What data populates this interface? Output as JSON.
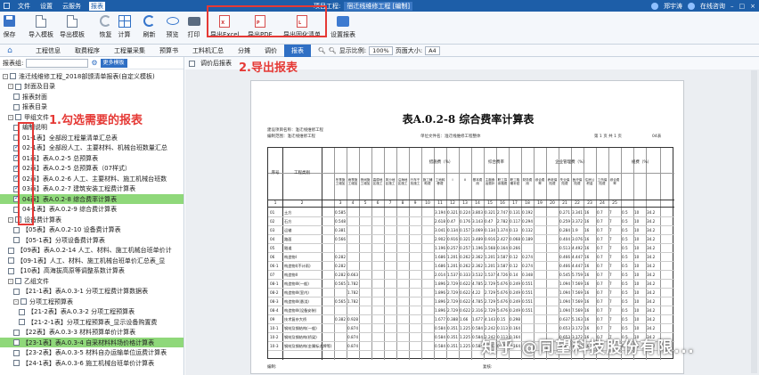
{
  "titlebar": {
    "menus": [
      "文件",
      "设置",
      "云服务",
      "报表"
    ],
    "active_menu": "报表",
    "center": "项目工程:",
    "project": "宿迁线维修工程 [编制]",
    "right": [
      "郑宇涛",
      "在线咨询",
      "–",
      "□",
      "×"
    ]
  },
  "toolbar": {
    "buttons": [
      {
        "label": "保存",
        "icon": "save-icon"
      },
      {
        "label": "导入模板",
        "icon": "import-icon"
      },
      {
        "label": "导出模板",
        "icon": "export-template-icon"
      },
      {
        "label": "恢复",
        "icon": "restore-icon"
      },
      {
        "label": "计算",
        "icon": "calculate-icon"
      },
      {
        "label": "刷新",
        "icon": "refresh-icon"
      },
      {
        "label": "预览",
        "icon": "preview-icon"
      },
      {
        "label": "打印",
        "icon": "print-icon"
      },
      {
        "label": "导出Excel",
        "icon": "excel-icon"
      },
      {
        "label": "导出PDF",
        "icon": "pdf-icon"
      },
      {
        "label": "导出固化清单",
        "icon": "export-list-icon"
      },
      {
        "label": "设置报表",
        "icon": "settings-icon"
      }
    ]
  },
  "tabs": [
    "工程信息",
    "取费程序",
    "工程量采集",
    "预算书",
    "工料机汇总",
    "分摊",
    "调价",
    "报表"
  ],
  "active_tab": "报表",
  "zoom": {
    "label": "显示比例:",
    "value": "100%",
    "page_label": "页面大小:",
    "page_value": "A4"
  },
  "left": {
    "search_label": "报表组:",
    "button": "更多模板",
    "after_label": "调价后报表"
  },
  "tree": [
    {
      "lvl": 0,
      "tog": "-",
      "cb": false,
      "text": "淮迁线维修工程_2018部颁清单报表(自定义模板)"
    },
    {
      "lvl": 1,
      "tog": "-",
      "cb": false,
      "text": "封面及目录"
    },
    {
      "lvl": 2,
      "cb": false,
      "text": "报表封面"
    },
    {
      "lvl": 2,
      "cb": false,
      "text": "报表目录"
    },
    {
      "lvl": 1,
      "tog": "-",
      "cb": false,
      "text": "甲组文件"
    },
    {
      "lvl": 2,
      "cb": false,
      "text": "编制说明"
    },
    {
      "lvl": 2,
      "cb": false,
      "text": "01-1表】全部段工程量清单汇总表"
    },
    {
      "lvl": 2,
      "cb": true,
      "text": "02-1表】全部段人工、主要材料、机械台班数量汇总"
    },
    {
      "lvl": 2,
      "cb": true,
      "text": "01表】表A.0.2-5 总预算表"
    },
    {
      "lvl": 2,
      "cb": true,
      "text": "02表】表A.0.2-5 总预算表（07样式）"
    },
    {
      "lvl": 2,
      "cb": true,
      "text": "02表】表A.0.2-6 人工、主要材料、施工机械台班数"
    },
    {
      "lvl": 2,
      "cb": true,
      "text": "03表】表A.0.2-7 建筑安装工程费计算表"
    },
    {
      "lvl": 2,
      "cb": true,
      "text": "04表】表A.0.2-8 综合费率计算表",
      "hl": true
    },
    {
      "lvl": 2,
      "cb": false,
      "text": "04-1表】表A.0.2-9 综合费计算表"
    },
    {
      "lvl": 1,
      "tog": "-",
      "cb": false,
      "text": "设备费计算表"
    },
    {
      "lvl": 2,
      "cb": false,
      "text": "【05表】表A.0.2-10 设备费计算表"
    },
    {
      "lvl": 2,
      "cb": false,
      "text": "【05-1表】分项设备费计算表"
    },
    {
      "lvl": 1,
      "cb": false,
      "text": "【09表】表A.0.2-14 人工、材料、施工机械台班单价计"
    },
    {
      "lvl": 1,
      "cb": false,
      "text": "【09-1表】人工、材料、施工机械台班单价汇总表_显"
    },
    {
      "lvl": 1,
      "cb": false,
      "text": "【10表】高海拔高原等调整系数计算表"
    },
    {
      "lvl": 1,
      "tog": "-",
      "cb": false,
      "text": "乙组文件"
    },
    {
      "lvl": 2,
      "cb": false,
      "text": "【21-1表】表A.0.3-1 分项工程费计算数据表"
    },
    {
      "lvl": 2,
      "tog": "-",
      "cb": false,
      "text": "分项工程预算表"
    },
    {
      "lvl": 3,
      "cb": false,
      "text": "【21-2表】表A.0.3-2 分项工程预算表"
    },
    {
      "lvl": 3,
      "cb": false,
      "text": "【21-2-1表】分项工程预算表_显示设备购置费"
    },
    {
      "lvl": 2,
      "cb": false,
      "text": "【22表】表A.0.3-3 材料预算单价计算表"
    },
    {
      "lvl": 2,
      "cb": false,
      "text": "【23-1表】表A.0.3-4 自采材料料场价格计算表",
      "hl": true
    },
    {
      "lvl": 2,
      "cb": false,
      "text": "【23-2表】表A.0.3-5 材料自办运输单位运费计算表"
    },
    {
      "lvl": 2,
      "cb": false,
      "text": "【24-1表】表A.0.3-6 施工机械台班单价计算表"
    }
  ],
  "annotations": {
    "step1": "1.勾选需要的报表",
    "step2": "2.导出报表"
  },
  "report": {
    "title": "表A.0.2-8  综合费率计算表",
    "meta_left1": "建设项目名称：",
    "meta_left1_val": "淮迁线维修工程",
    "meta_left2": "编制范围：",
    "meta_left2_val": "淮迁线维修工程",
    "meta_mid": "单位文件名：淮迁线维修工程整体",
    "meta_right": "第 1 页  共 1 页",
    "meta_right2": "04表",
    "header_top": [
      "措施费（%）",
      "企业管理费（%）",
      "规费（%）"
    ],
    "sub_top": [
      "综合费率"
    ],
    "col_first": "序号",
    "col_name": "工程类别",
    "col_numbers": [
      "1",
      "2",
      "3",
      "4",
      "5",
      "6",
      "7",
      "8",
      "9",
      "10",
      "11",
      "12",
      "13",
      "14",
      "15",
      "16",
      "17",
      "18",
      "19",
      "20",
      "21",
      "22",
      "23",
      "24",
      "25"
    ],
    "rows": [
      {
        "no": "01",
        "name": "土方",
        "v": [
          "0.585",
          "",
          "",
          "",
          "",
          "",
          "",
          "",
          "3.194",
          "0.321",
          "0.224",
          "3.803",
          "0.321",
          "2.747",
          "0.131",
          "0.192",
          "",
          "",
          "0.271",
          "3.341",
          "16",
          "0.7",
          "7",
          "0.5",
          "10",
          "34.2"
        ]
      },
      {
        "no": "02",
        "name": "石方",
        "v": [
          "0.548",
          "",
          "",
          "",
          "",
          "",
          "",
          "",
          "2.618",
          "0.47",
          "0.176",
          "3.143",
          "0.47",
          "2.782",
          "0.117",
          "0.294",
          "",
          "",
          "0.259",
          "3.372",
          "16",
          "0.7",
          "7",
          "0.5",
          "10",
          "34.2"
        ]
      },
      {
        "no": "03",
        "name": "运输",
        "v": [
          "0.381",
          "",
          "",
          "",
          "",
          "",
          "",
          "",
          "3.041",
          "0.134",
          "0.157",
          "3.069",
          "0.134",
          "1.374",
          "0.13",
          "0.132",
          "",
          "",
          "0.284",
          "1.9",
          "16",
          "0.7",
          "7",
          "0.5",
          "10",
          "34.2"
        ]
      },
      {
        "no": "04",
        "name": "路面",
        "v": [
          "0.566",
          "",
          "",
          "",
          "",
          "",
          "",
          "",
          "2.902",
          "0.916",
          "0.321",
          "3.489",
          "0.916",
          "2.427",
          "0.068",
          "0.189",
          "",
          "",
          "0.404",
          "3.076",
          "16",
          "0.7",
          "7",
          "0.5",
          "10",
          "34.2"
        ]
      },
      {
        "no": "05",
        "name": "隧道",
        "v": [
          "",
          "",
          "",
          "",
          "",
          "",
          "",
          "",
          "1.196",
          "0.257",
          "0.257",
          "1.196",
          "3.568",
          "0.164",
          "0.266",
          "",
          "",
          "",
          "0.513",
          "4.492",
          "16",
          "0.7",
          "7",
          "0.5",
          "10",
          "34.2"
        ]
      },
      {
        "no": "06",
        "name": "构造物I",
        "v": [
          "0.282",
          "",
          "",
          "",
          "",
          "",
          "",
          "",
          "1.686",
          "1.201",
          "0.262",
          "2.362",
          "1.201",
          "3.587",
          "0.12",
          "0.274",
          "",
          "",
          "0.466",
          "4.447",
          "16",
          "0.7",
          "7",
          "0.5",
          "10",
          "34.2"
        ]
      },
      {
        "no": "06-1",
        "name": "构造物I(不计雨)",
        "v": [
          "0.282",
          "",
          "",
          "",
          "",
          "",
          "",
          "",
          "1.686",
          "1.201",
          "0.262",
          "2.362",
          "1.201",
          "3.587",
          "0.12",
          "0.274",
          "",
          "",
          "0.466",
          "4.447",
          "16",
          "0.7",
          "7",
          "0.5",
          "10",
          "34.2"
        ]
      },
      {
        "no": "07",
        "name": "构造物II",
        "v": [
          "0.282",
          "0.663",
          "",
          "",
          "",
          "",
          "",
          "",
          "2.014",
          "1.537",
          "0.333",
          "3.532",
          "1.537",
          "4.726",
          "0.14",
          "0.348",
          "",
          "",
          "0.545",
          "5.759",
          "16",
          "0.7",
          "7",
          "0.5",
          "10",
          "34.2"
        ]
      },
      {
        "no": "08-1",
        "name": "构造物III(一般)",
        "v": [
          "0.565",
          "1.782",
          "",
          "",
          "",
          "",
          "",
          "",
          "1.896",
          "2.729",
          "0.622",
          "4.785",
          "2.729",
          "5.676",
          "0.249",
          "0.551",
          "",
          "",
          "1.094",
          "7.569",
          "16",
          "0.7",
          "7",
          "0.5",
          "10",
          "34.2"
        ]
      },
      {
        "no": "08-2",
        "name": "构造物III(室内)",
        "v": [
          "",
          "1.782",
          "",
          "",
          "",
          "",
          "",
          "",
          "1.896",
          "2.729",
          "0.622",
          "4.22",
          "2.729",
          "5.676",
          "0.249",
          "0.551",
          "",
          "",
          "1.094",
          "7.569",
          "16",
          "0.7",
          "7",
          "0.5",
          "10",
          "34.2"
        ]
      },
      {
        "no": "08-3",
        "name": "构造物III(悬浇)",
        "v": [
          "0.565",
          "1.782",
          "",
          "",
          "",
          "",
          "",
          "",
          "1.896",
          "2.729",
          "0.622",
          "4.785",
          "2.729",
          "5.676",
          "0.249",
          "0.551",
          "",
          "",
          "1.094",
          "7.569",
          "16",
          "0.7",
          "7",
          "0.5",
          "10",
          "34.2"
        ]
      },
      {
        "no": "08-4",
        "name": "构造物III(设备安装)",
        "v": [
          "",
          "",
          "",
          "",
          "",
          "",
          "",
          "",
          "1.896",
          "2.729",
          "0.622",
          "2.316",
          "2.729",
          "5.676",
          "0.249",
          "0.551",
          "",
          "",
          "1.094",
          "7.569",
          "16",
          "0.7",
          "7",
          "0.5",
          "10",
          "34.2"
        ]
      },
      {
        "no": "09",
        "name": "技术复杂大桥",
        "v": [
          "0.382",
          "0.928",
          "",
          "",
          "",
          "",
          "",
          "",
          "1.677",
          "0.388",
          "1.66",
          "1.677",
          "4.143",
          "0.15",
          "0.298",
          "",
          "",
          "",
          "0.637",
          "5.163",
          "16",
          "0.7",
          "7",
          "0.5",
          "10",
          "34.2"
        ]
      },
      {
        "no": "10-1",
        "name": "钢材及钢结构(一般)",
        "v": [
          "",
          "0.874",
          "",
          "",
          "",
          "",
          "",
          "",
          "0.584",
          "0.351",
          "1.225",
          "0.584",
          "2.242",
          "0.113",
          "0.164",
          "",
          "",
          "",
          "0.653",
          "3.172",
          "16",
          "0.7",
          "7",
          "0.5",
          "10",
          "34.2"
        ]
      },
      {
        "no": "10-2",
        "name": "钢材及钢结构(桥梁)",
        "v": [
          "",
          "0.874",
          "",
          "",
          "",
          "",
          "",
          "",
          "0.584",
          "0.351",
          "1.225",
          "0.584",
          "2.242",
          "0.113",
          "0.164",
          "",
          "",
          "",
          "0.653",
          "3.172",
          "16",
          "0.7",
          "7",
          "0.5",
          "10",
          "34.2"
        ]
      },
      {
        "no": "10-3",
        "name": "钢材及钢结构(金属标志牌等)",
        "v": [
          "",
          "0.874",
          "",
          "",
          "",
          "",
          "",
          "",
          "0.584",
          "0.351",
          "1.225",
          "0.584",
          "2.242",
          "0.113",
          "0.164",
          "",
          "",
          "",
          "0.653",
          "3.172",
          "16",
          "0.7",
          "7",
          "0.5",
          "10",
          "34.2"
        ]
      }
    ],
    "foot_left": "编制:",
    "foot_right": "复核:"
  },
  "watermark": "知乎 @同望科技股份有限..."
}
